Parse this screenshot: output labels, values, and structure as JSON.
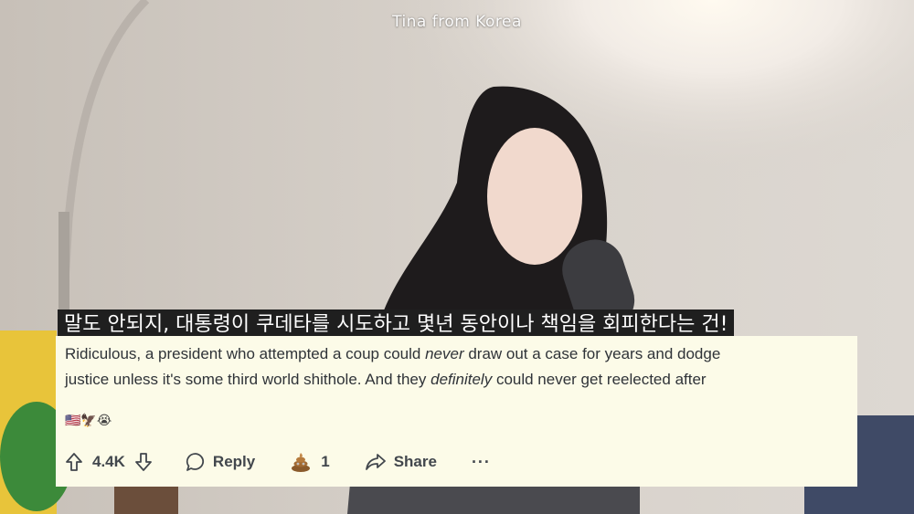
{
  "video": {
    "watermark": "Tina from Korea"
  },
  "subtitle": {
    "text": "말도 안되지, 대통령이 쿠데타를 시도하고 몇년 동안이나 책임을 회피한다는 건!"
  },
  "comment": {
    "line1_before": "Ridiculous, a president who attempted a coup could ",
    "line1_em": "never",
    "line1_after": " draw out a case for years and dodge",
    "line2_before": "justice unless it's some third world shithole. And they ",
    "line2_em": "definitely",
    "line2_after": " could never get reelected after",
    "emojis": "🇺🇸🦅😭"
  },
  "actions": {
    "upvote_icon": "upvote-arrow-icon",
    "vote_count": "4.4K",
    "downvote_icon": "downvote-arrow-icon",
    "reply_label": "Reply",
    "award_icon": "poop-award-icon",
    "award_count": "1",
    "share_label": "Share",
    "more_label": "···"
  },
  "colors": {
    "card_background": "#fcfbe8",
    "subtitle_background": "#1f1f1f",
    "text": "#2f3338"
  }
}
